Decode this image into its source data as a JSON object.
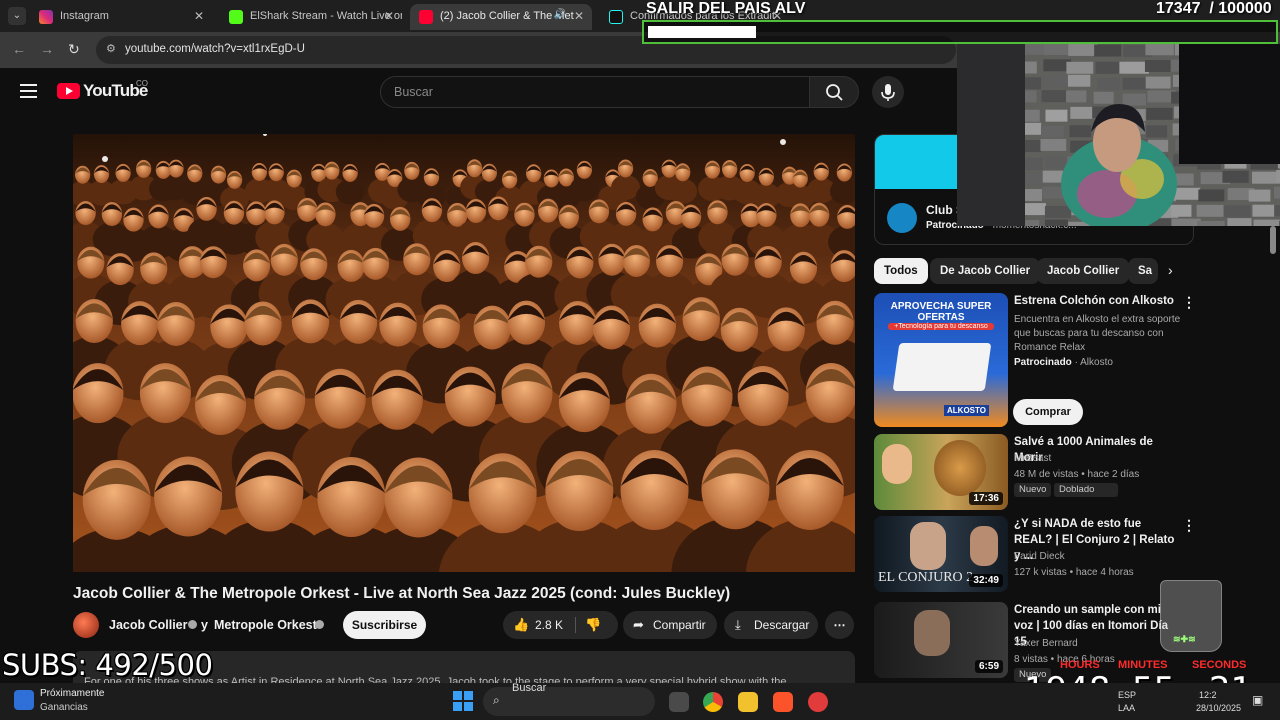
{
  "browser": {
    "tabs": [
      {
        "label": "Instagram",
        "active": false
      },
      {
        "label": "ElShark Stream - Watch Live on",
        "active": false
      },
      {
        "label": "(2) Jacob Collier & The Met",
        "active": true
      },
      {
        "label": "Confirmados para los Extradit",
        "active": false
      }
    ],
    "url": "youtube.com/watch?v=xtl1rxEgD-U"
  },
  "masthead": {
    "logo_text": "YouTube",
    "country": "CO",
    "search_placeholder": "Buscar"
  },
  "video": {
    "title": "Jacob Collier & The Metropole Orkest - Live at North Sea Jazz 2025 (cond: Jules Buckley)",
    "owner_1": "Jacob Collier",
    "owner_joiner": "y",
    "owner_2": "Metropole Orkest",
    "subscribe_label": "Suscribirse",
    "likes": "2.8 K",
    "share_label": "Compartir",
    "download_label": "Descargar",
    "description": "For one of his three shows as Artist in Residence at North Sea Jazz 2025, Jacob took to the stage to perform a very special hybrid show with the"
  },
  "ad_card": {
    "name": "Club S",
    "sponsored": "Patrocinado",
    "domain": "momentosnack.c..."
  },
  "chips": [
    "Todos",
    "De Jacob Collier",
    "Jacob Collier",
    "Sa"
  ],
  "related": [
    {
      "title": "Estrena Colchón con Alkosto",
      "desc": "Encuentra en Alkosto el extra soporte que buscas para tu descanso con Romance Relax",
      "sponsored": "Patrocinado",
      "advertiser": "Alkosto",
      "cta": "Comprar",
      "thumb_title": "APROVECHA SUPER OFERTAS",
      "thumb_sub": "+Tecnología para tu descanso",
      "thumb_logo": "ALKOSTO"
    },
    {
      "title": "Salvé a 1000 Animales de Morir",
      "channel": "MrBeast",
      "meta": "48 M de vistas • hace 2 días",
      "badges": [
        "Nuevo",
        "Doblado"
      ],
      "duration": "17:36"
    },
    {
      "title": "¿Y si NADA de esto fue REAL? | El Conjuro 2 | Relato y ...",
      "channel": "Farid Dieck",
      "meta": "127 k vistas • hace 4 horas",
      "badges": [
        "Nuevo"
      ],
      "duration": "32:49",
      "thumb_text": "EL CONJURO 2"
    },
    {
      "title": "Creando un sample con mi voz | 100 días en Itomori Día 15",
      "channel": "Yaxer Bernard",
      "meta": "8 vistas • hace 6 horas",
      "badges": [
        "Nuevo"
      ],
      "duration": "6:59"
    }
  ],
  "overlay": {
    "goal_title": "SALIR DEL PAIS ALV",
    "goal_current": "17347",
    "goal_total": "/ 100000",
    "goal_progress": 0.173,
    "subs_text": "SUBS: 492/500",
    "timer": [
      {
        "label": "HOURS",
        "value": "1948"
      },
      {
        "label": "MINUTES",
        "value": "55"
      },
      {
        "label": "SECONDS",
        "value": "21"
      }
    ],
    "cup_text": "≋✚≋"
  },
  "taskbar": {
    "weather_title": "Próximamente",
    "weather_sub": "Ganancias",
    "search_label": "Buscar",
    "lang_1": "ESP",
    "lang_2": "LAA",
    "time": "12:2",
    "date": "28/10/2025"
  },
  "colors": {
    "youtube_red": "#ff0033",
    "goal_green": "#4fbf3a",
    "timer_red": "#ff2b2b"
  }
}
